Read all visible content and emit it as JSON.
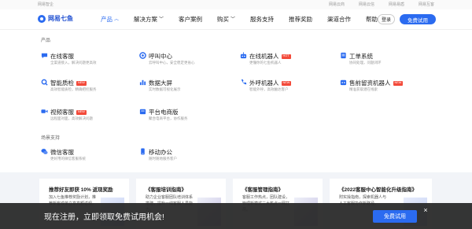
{
  "topbar": {
    "brand": "网易智企",
    "links": [
      "网易云商",
      "网易云信",
      "网易易盾",
      "网易互客"
    ]
  },
  "header": {
    "logo_text": "网易七鱼",
    "nav": [
      {
        "label": "产品",
        "has_chevron": true
      },
      {
        "label": "解决方案",
        "has_chevron": true
      },
      {
        "label": "客户案例",
        "has_chevron": false
      },
      {
        "label": "购买",
        "has_chevron": true
      },
      {
        "label": "服务支持",
        "has_chevron": false
      },
      {
        "label": "推荐奖励",
        "has_chevron": false
      },
      {
        "label": "渠道合作",
        "has_chevron": false
      },
      {
        "label": "帮助",
        "has_chevron": true
      }
    ],
    "login_label": "登录",
    "trial_label": "免费试用"
  },
  "dropdown": {
    "section_product": "产品",
    "section_scene": "场景支持",
    "products": [
      {
        "name": "在线客服",
        "desc": "全渠道接入，解决问题更高效",
        "badge": "",
        "icon": "chat-bubble-icon"
      },
      {
        "name": "呼叫中心",
        "desc": "云呼叫中心，安全稳定更省心",
        "badge": "",
        "icon": "phone-icon"
      },
      {
        "name": "在线机器人",
        "desc": "更懂你的七鱼机器人",
        "badge": "HOT",
        "icon": "robot-icon"
      },
      {
        "name": "工单系统",
        "desc": "协同处理，问题闭环",
        "badge": "",
        "icon": "ticket-icon"
      },
      {
        "name": "智能质检",
        "desc": "高效智能质检，精确把控服务",
        "badge": "NEW",
        "icon": "quality-check-icon"
      },
      {
        "name": "数据大屏",
        "desc": "实时数据可视化展示",
        "badge": "",
        "icon": "data-screen-icon"
      },
      {
        "name": "外呼机器人",
        "desc": "智能外呼，高效触达客户",
        "badge": "NEW",
        "icon": "outbound-robot-icon"
      },
      {
        "name": "售前留资机器人",
        "desc": "精准获取潜在线索",
        "badge": "NEW",
        "icon": "lead-robot-icon"
      },
      {
        "name": "视频客服",
        "desc": "远程面对面，高效解决问题",
        "badge": "NEW",
        "icon": "video-icon"
      },
      {
        "name": "平台电商版",
        "desc": "聚合电商平台，协作服务",
        "badge": "",
        "icon": "ecommerce-icon"
      }
    ],
    "scenes": [
      {
        "name": "微信客服",
        "desc": "更好用的微信客服系统",
        "badge": "",
        "icon": "wechat-icon"
      },
      {
        "name": "移动办公",
        "desc": "随时随地服务客户",
        "badge": "",
        "icon": "mobile-icon"
      }
    ]
  },
  "cards": [
    {
      "title": "推荐好友即获 10% 返现奖励",
      "text": "加入七鱼推荐奖励计划，推荐新客成单立享高额返现。"
    },
    {
      "title": "《客服培训指南》",
      "text": "助力企业客服团队培训体系搭建，提升一线客服人员能力。"
    },
    {
      "title": "《客服管理指南》",
      "text": "客服工作热点，团队建设，管理新模式三大热点一网打尽。"
    },
    {
      "title": "《2022客服中心智能化升级指南》",
      "text": "附实操指南，探索机器人与人工客服协作新路径。"
    }
  ],
  "banner": {
    "text": "现在注册，立即领取免费试用机会!",
    "button": "免费试用",
    "close": "×"
  },
  "colors": {
    "accent": "#2b6bf0",
    "badge": "#f34a3a",
    "banner_bg": "#262626"
  }
}
